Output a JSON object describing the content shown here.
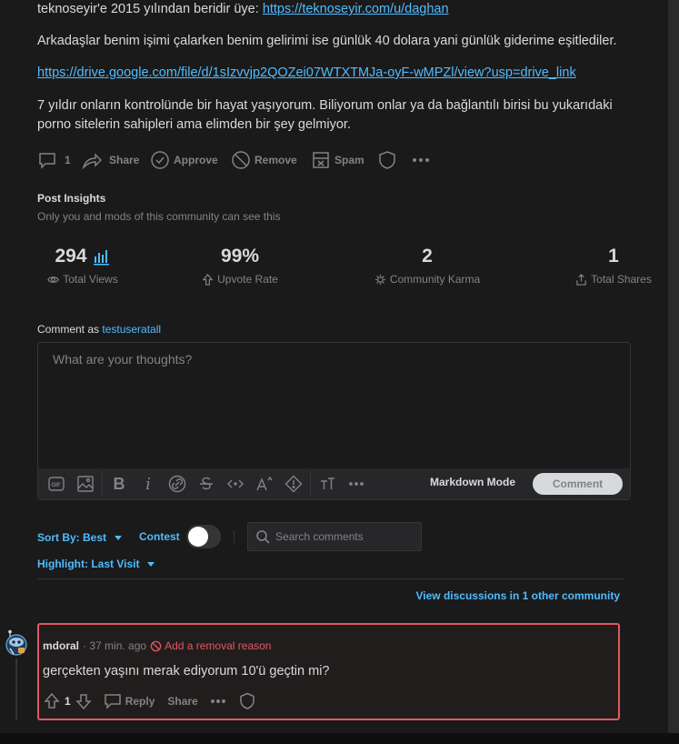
{
  "post": {
    "line1_prefix": "teknoseyir'e 2015 yılından beridir üye: ",
    "line1_link": "https://teknoseyir.com/u/daghan",
    "line2": "Arkadaşlar benim işimi çalarken benim gelirimi ise günlük 40 dolara yani günlük giderime eşitlediler.",
    "line3_link": "https://drive.google.com/file/d/1sIzvvjp2QOZei07WTXTMJa-oyF-wMPZl/view?usp=drive_link",
    "line4a": "7 yıldır onların kontrolünde bir hayat yaşıyorum. Biliyorum onlar ya da bağlantılı birisi bu yukarıdaki",
    "line4b": "porno sitelerin sahipleri ama elimden bir şey gelmiyor."
  },
  "actions": {
    "comments_count": "1",
    "share": "Share",
    "approve": "Approve",
    "remove": "Remove",
    "spam": "Spam"
  },
  "insights": {
    "title": "Post Insights",
    "subtitle": "Only you and mods of this community can see this",
    "stats": [
      {
        "value": "294",
        "label": "Total Views",
        "icon": "eye-icon"
      },
      {
        "value": "99%",
        "label": "Upvote Rate",
        "icon": "upvote-icon"
      },
      {
        "value": "2",
        "label": "Community Karma",
        "icon": "karma-icon"
      },
      {
        "value": "1",
        "label": "Total Shares",
        "icon": "share-icon"
      }
    ]
  },
  "composer": {
    "comment_as_prefix": "Comment as ",
    "username": "testuseratall",
    "placeholder": "What are your thoughts?",
    "markdown_mode": "Markdown Mode",
    "submit": "Comment"
  },
  "sort": {
    "sort_by": "Sort By: Best",
    "contest": "Contest",
    "search_placeholder": "Search comments",
    "highlight": "Highlight: Last Visit",
    "view_discussions": "View discussions in 1 other community"
  },
  "comment": {
    "author": "mdoral",
    "time": "· 37 min. ago",
    "removal": "Add a removal reason",
    "text": "gerçekten yaşını merak ediyorum 10'ü geçtin mi?",
    "votes": "1",
    "reply": "Reply",
    "share": "Share"
  },
  "colors": {
    "background": "#1a1a1b",
    "link": "#4fbcff",
    "removal_border": "#e0585f"
  }
}
